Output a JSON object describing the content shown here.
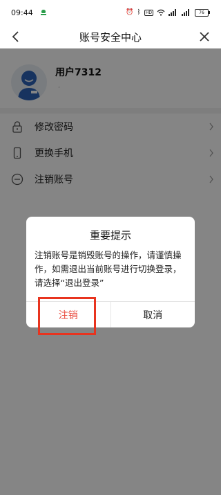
{
  "status_bar": {
    "time": "09:44",
    "badge": "HD",
    "battery": "76"
  },
  "nav": {
    "title": "账号安全中心"
  },
  "profile": {
    "username": "用户7312"
  },
  "menu": {
    "items": [
      {
        "label": "修改密码",
        "icon": "lock-icon"
      },
      {
        "label": "更换手机",
        "icon": "phone-icon"
      },
      {
        "label": "注销账号",
        "icon": "minus-circle-icon"
      }
    ]
  },
  "dialog": {
    "title": "重要提示",
    "message": "注销账号是销毁账号的操作，请谨慎操作，如需退出当前账号进行切换登录，请选择“退出登录”",
    "confirm_label": "注销",
    "cancel_label": "取消"
  },
  "colors": {
    "accent": "#e94a3d",
    "highlight": "#e8341f"
  }
}
